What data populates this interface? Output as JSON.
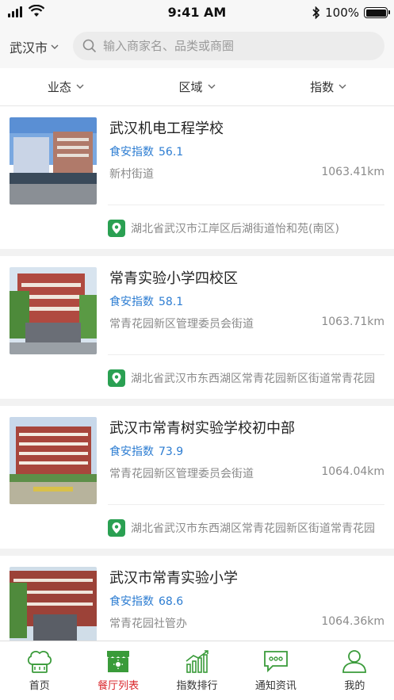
{
  "status_bar": {
    "time": "9:41 AM",
    "battery": "100%",
    "battery_level": 1.0
  },
  "header": {
    "city": "武汉市",
    "search_placeholder": "输入商家名、品类或商圈"
  },
  "filters": [
    {
      "label": "业态"
    },
    {
      "label": "区域"
    },
    {
      "label": "指数"
    }
  ],
  "index_label": "食安指数",
  "list": [
    {
      "name": "武汉机电工程学校",
      "index_value": "56.1",
      "street": "新村街道",
      "distance": "1063.41km",
      "address": "湖北省武汉市江岸区后湖街道怡和苑(南区)"
    },
    {
      "name": "常青实验小学四校区",
      "index_value": "58.1",
      "street": "常青花园新区管理委员会街道",
      "distance": "1063.71km",
      "address": "湖北省武汉市东西湖区常青花园新区街道常青花园"
    },
    {
      "name": "武汉市常青树实验学校初中部",
      "index_value": "73.9",
      "street": "常青花园新区管理委员会街道",
      "distance": "1064.04km",
      "address": "湖北省武汉市东西湖区常青花园新区街道常青花园"
    },
    {
      "name": "武汉市常青实验小学",
      "index_value": "68.6",
      "street": "常青花园社管办",
      "distance": "1064.36km",
      "address": ""
    }
  ],
  "tabs": [
    {
      "label": "首页",
      "icon": "chef-hat-icon"
    },
    {
      "label": "餐厅列表",
      "icon": "restaurant-icon",
      "active": true
    },
    {
      "label": "指数排行",
      "icon": "ranking-chart-icon"
    },
    {
      "label": "通知资讯",
      "icon": "message-icon"
    },
    {
      "label": "我的",
      "icon": "user-icon"
    }
  ],
  "colors": {
    "accent_blue": "#2d7dd2",
    "active_red": "#d9252a",
    "icon_green": "#3a9b3a",
    "pin_green": "#2aa052"
  }
}
